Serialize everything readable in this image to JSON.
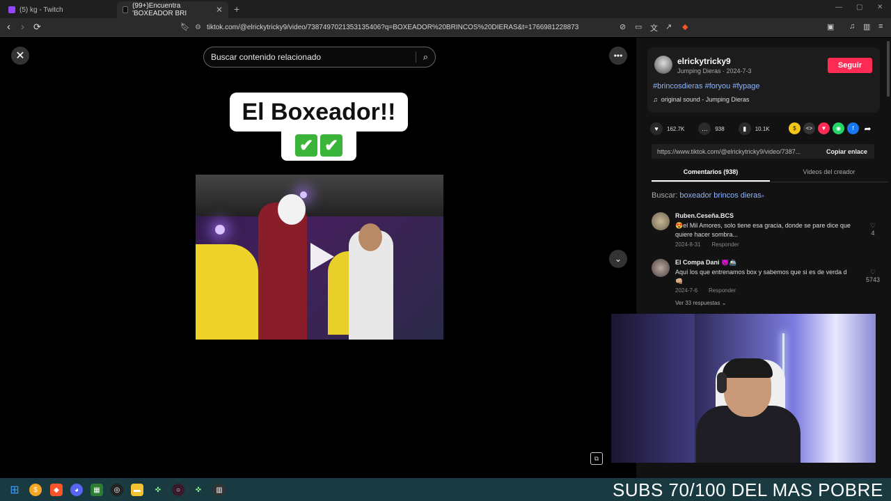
{
  "browser": {
    "tabs": [
      {
        "label": "(5) kg - Twitch",
        "favicon_color": "#9146ff"
      },
      {
        "label": "(99+)Encuentra 'BOXEADOR BRI",
        "favicon_color": "#111111"
      }
    ],
    "url": "tiktok.com/@elrickytricky9/video/7387497021353135406?q=BOXEADOR%20BRINCOS%20DIERAS&t=1766981228873"
  },
  "search": {
    "placeholder": "Buscar contenido relacionado"
  },
  "video": {
    "title_text": "El Boxeador!!",
    "checks": [
      "✔",
      "✔"
    ]
  },
  "author": {
    "username": "elrickytricky9",
    "meta": "Jumping Dieras · 2024-7-3",
    "follow_label": "Seguir",
    "hashtags": "#brincosdieras #foryou #fypage",
    "sound": "original sound - Jumping Dieras"
  },
  "stats": {
    "likes": "162.7K",
    "comments": "938",
    "saves": "10.1K"
  },
  "share": {
    "link": "https://www.tiktok.com/@elrickytricky9/video/7387...",
    "copy_label": "Copiar enlace"
  },
  "tabs": {
    "comments": "Comentarios (938)",
    "creator_videos": "Videos del creador"
  },
  "buscar": {
    "label": "Buscar:",
    "query": "boxeador brincos dieras"
  },
  "comments": [
    {
      "name": "Ruben.Ceseña.BCS",
      "text": "😍el Mil Amores, solo tiene esa gracia, donde se pare dice que quiere hacer sombra...",
      "date": "2024-8-31",
      "reply": "Responder",
      "likes": "4"
    },
    {
      "name": "El Compa Dani 😈🚢",
      "text": "Aquí los que entrenamos box y sabemos que si es de verda d 👊🏼",
      "date": "2024-7-6",
      "reply": "Responder",
      "likes": "5743",
      "replies": "Ver 33 respuestas ⌄"
    }
  ],
  "ticker": "SUBS 70/100 DEL MAS POBRE"
}
